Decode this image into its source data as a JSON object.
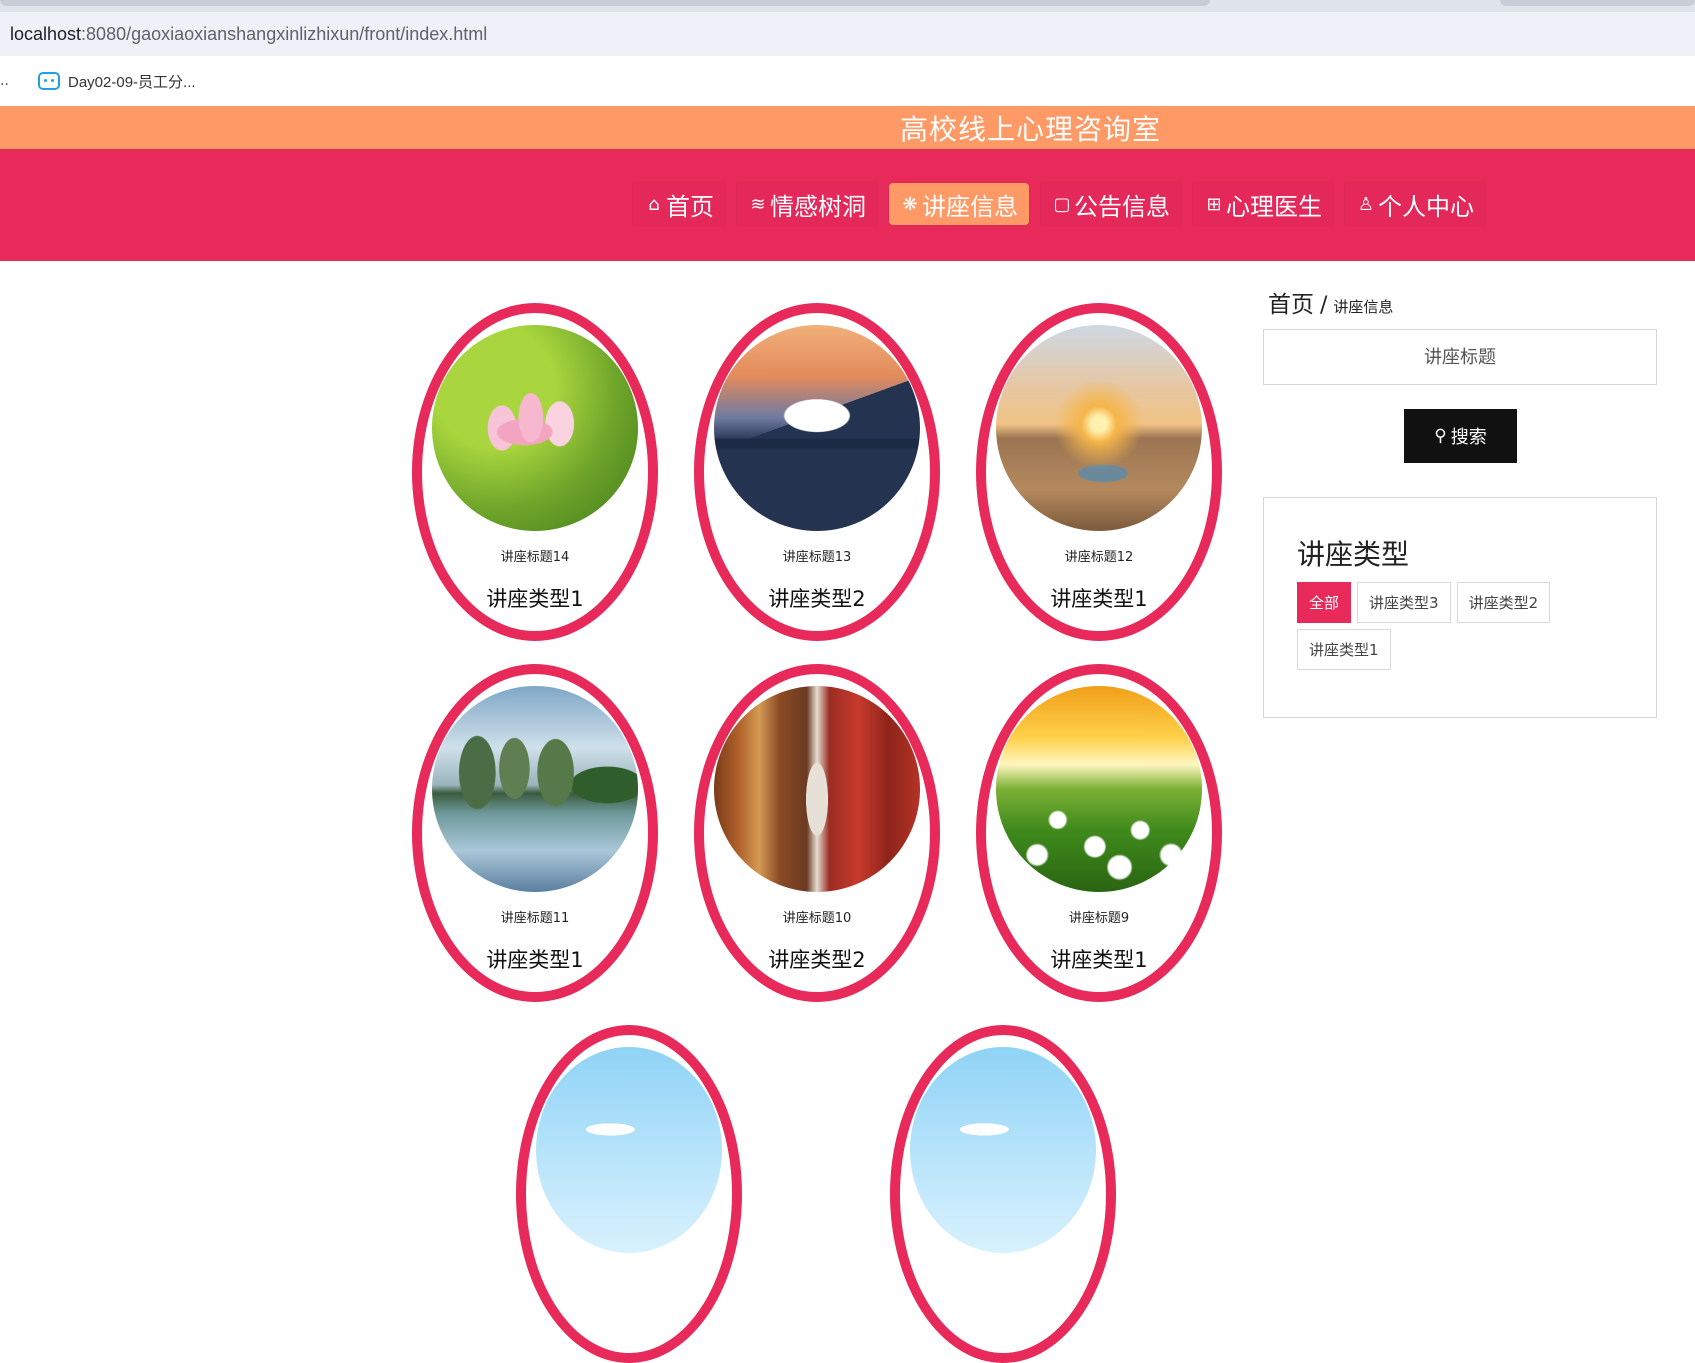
{
  "browser": {
    "url_host": "localhost",
    "url_path": ":8080/gaoxiaoxianshangxinlizhixun/front/index.html",
    "bookmark_prefix": "..",
    "bookmark_label": "Day02-09-员工分..."
  },
  "site": {
    "title": "高校线上心理咨询室"
  },
  "nav": {
    "items": [
      {
        "icon": "⌂",
        "label": "首页",
        "active": false
      },
      {
        "icon": "≋",
        "label": "情感树洞",
        "active": false
      },
      {
        "icon": "❋",
        "label": "讲座信息",
        "active": true
      },
      {
        "icon": "▢",
        "label": "公告信息",
        "active": false
      },
      {
        "icon": "⊞",
        "label": "心理医生",
        "active": false
      },
      {
        "icon": "♙",
        "label": "个人中心",
        "active": false
      }
    ]
  },
  "lectures": [
    {
      "title": "讲座标题14",
      "type": "讲座类型1",
      "image": "lotus"
    },
    {
      "title": "讲座标题13",
      "type": "讲座类型2",
      "image": "fuji-city"
    },
    {
      "title": "讲座标题12",
      "type": "讲座类型1",
      "image": "desert-sunset"
    },
    {
      "title": "讲座标题11",
      "type": "讲座类型1",
      "image": "karst-lake"
    },
    {
      "title": "讲座标题10",
      "type": "讲座类型2",
      "image": "temple-corridor"
    },
    {
      "title": "讲座标题9",
      "type": "讲座类型1",
      "image": "daisy-field"
    },
    {
      "image": "sky"
    },
    {
      "image": "sky"
    }
  ],
  "sidebar": {
    "breadcrumb_home": "首页",
    "breadcrumb_sep": "/",
    "breadcrumb_current": "讲座信息",
    "search_placeholder": "讲座标题",
    "search_icon": "⚲",
    "search_label": "搜索",
    "type_title": "讲座类型",
    "tags": [
      {
        "label": "全部",
        "active": true
      },
      {
        "label": "讲座类型3",
        "active": false
      },
      {
        "label": "讲座类型2",
        "active": false
      },
      {
        "label": "讲座类型1",
        "active": false
      }
    ]
  },
  "colors": {
    "accent": "#e72a5a",
    "title_bar": "#ff9966",
    "active_nav": "#ff9966"
  }
}
